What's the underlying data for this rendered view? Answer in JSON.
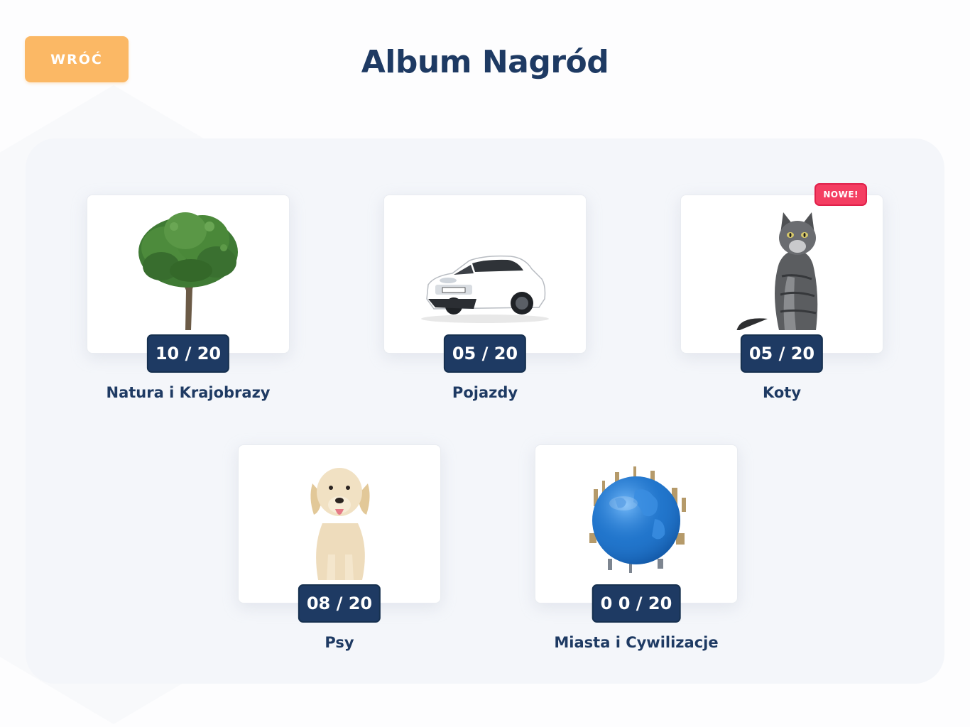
{
  "header": {
    "back_label": "WRÓĆ",
    "title": "Album Nagród"
  },
  "albums": [
    {
      "name": "Natura i Krajobrazy",
      "progress": "10 / 20",
      "icon": "tree-icon"
    },
    {
      "name": "Pojazdy",
      "progress": "05 / 20",
      "icon": "car-icon"
    },
    {
      "name": "Koty",
      "progress": "05 / 20",
      "icon": "cat-icon",
      "tag": "NOWE!"
    },
    {
      "name": "Psy",
      "progress": "08 / 20",
      "icon": "dog-icon"
    },
    {
      "name": "Miasta i Cywilizacje",
      "progress": "0 0 / 20",
      "icon": "globe-icon"
    }
  ],
  "colors": {
    "accent": "#fbb865",
    "navy": "#1e3a63",
    "new_tag": "#f43e62"
  }
}
